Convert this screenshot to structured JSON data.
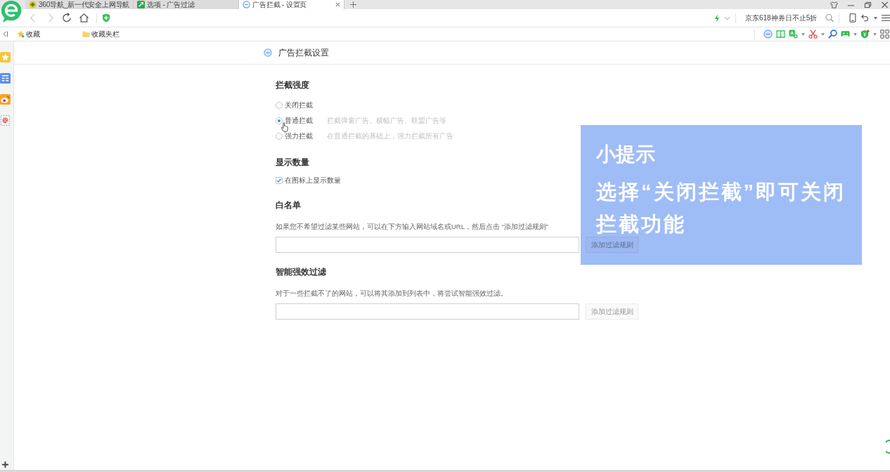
{
  "browser": {
    "tabs": [
      {
        "title": "360导航_新一代安全上网导航",
        "selected": false,
        "kind": "nav"
      },
      {
        "title": "选项 - 广告过滤",
        "selected": false,
        "kind": "options"
      },
      {
        "title": "广告拦截 - 设置页",
        "selected": true,
        "kind": "adblock"
      }
    ],
    "nav_buttons": [
      {
        "kind": "back",
        "disabled": true
      },
      {
        "kind": "forward",
        "disabled": true
      },
      {
        "kind": "refresh",
        "disabled": false
      },
      {
        "kind": "home",
        "disabled": false
      }
    ],
    "search": {
      "placeholder": "京东618神券日不止5折"
    },
    "bookmarks": [
      {
        "label": "收藏",
        "kind": "favorites"
      },
      {
        "label": "收藏夹栏",
        "kind": "folder"
      }
    ]
  },
  "page": {
    "title": "广告拦截设置",
    "sections": [
      {
        "heading": "拦截强度",
        "kind": "radios",
        "options": [
          {
            "label": "关闭拦截",
            "selected": false
          },
          {
            "label": "普通拦截",
            "selected": true,
            "description": "拦截弹窗广告、横幅广告、联盟广告等"
          },
          {
            "label": "强力拦截",
            "selected": false,
            "description": "在普通拦截的基础上，强力拦截所有广告"
          }
        ]
      },
      {
        "heading": "显示数量",
        "kind": "checkbox",
        "label": "在图标上显示数量",
        "checked": true
      },
      {
        "heading": "白名单",
        "kind": "rule",
        "description": "如果您不希望过滤某些网站，可以在下方输入网站域名或URL，然后点击 “添加过滤规则”",
        "button": {
          "label": "添加过滤规则",
          "disabled": true
        }
      },
      {
        "heading": "智能强效过滤",
        "kind": "rule",
        "description": "对于一些拦截不了的网站，可以将其添加到列表中，将尝试智能强效过滤。",
        "button": {
          "label": "添加过滤规则",
          "disabled": true
        }
      }
    ]
  },
  "tip": {
    "title": "小提示",
    "text": "选择“关闭拦截”即可关闭拦截功能"
  }
}
